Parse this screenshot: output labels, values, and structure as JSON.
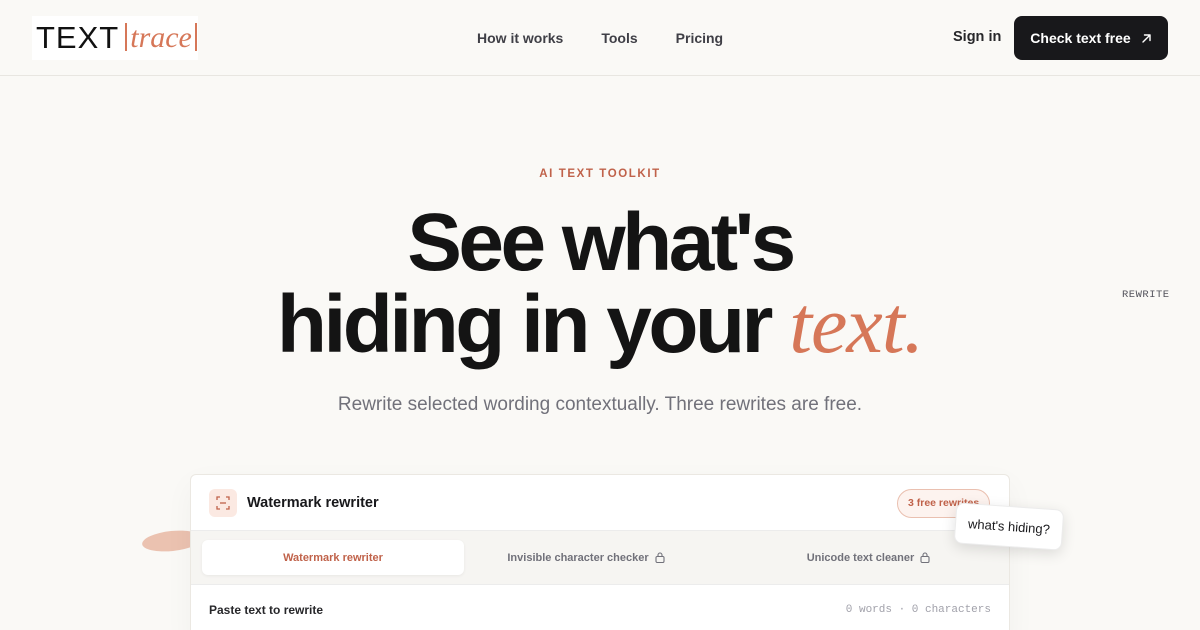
{
  "header": {
    "logo": {
      "main": "TEXT",
      "accent": "trace"
    },
    "nav": [
      {
        "label": "How it works"
      },
      {
        "label": "Tools"
      },
      {
        "label": "Pricing"
      }
    ],
    "sign_in": "Sign in",
    "cta_label": "Check text free",
    "cta_icon": "arrow-up-right-icon"
  },
  "hero": {
    "eyebrow": "AI TEXT TOOLKIT",
    "headline_line1": "See what's",
    "headline_line2": "hiding in your",
    "headline_accent": "text.",
    "subtitle": "Rewrite selected wording contextually. Three rewrites are free.",
    "side_label": "REWRITE"
  },
  "card": {
    "title": "Watermark rewriter",
    "icon": "scan-frame-icon",
    "badge": "3 free rewrites",
    "tabs": [
      {
        "label": "Watermark rewriter",
        "active": true,
        "locked": false
      },
      {
        "label": "Invisible character checker",
        "active": false,
        "locked": true
      },
      {
        "label": "Unicode text cleaner",
        "active": false,
        "locked": true
      }
    ],
    "paste_label": "Paste text to rewrite",
    "counts": "0 words · 0 characters"
  },
  "sticker": "what's hiding?",
  "colors": {
    "accent": "#d67758",
    "accent_dark": "#c0624a",
    "background": "#faf9f6",
    "button": "#18181b"
  }
}
